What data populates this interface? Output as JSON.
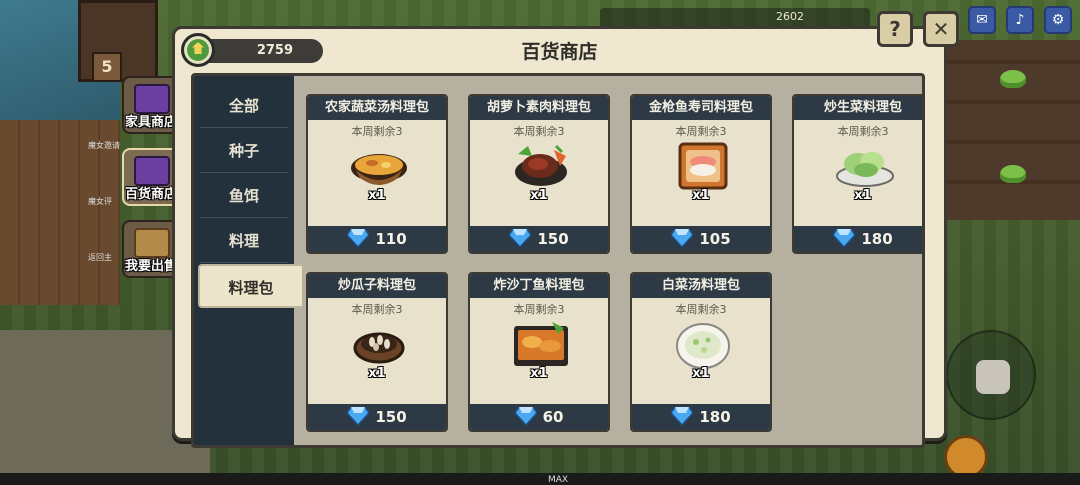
{
  "shop": {
    "title": "百货商店",
    "coins": "2759",
    "help_label": "?",
    "close_label": "✕"
  },
  "categories": [
    {
      "label": "全部",
      "active": false
    },
    {
      "label": "种子",
      "active": false
    },
    {
      "label": "鱼饵",
      "active": false
    },
    {
      "label": "料理",
      "active": false
    },
    {
      "label": "料理包",
      "active": true
    }
  ],
  "items": [
    {
      "name": "农家蔬菜汤料理包",
      "stock": "本周剩余3",
      "qty": "x1",
      "price": "110",
      "art": "soup-bowl-icon"
    },
    {
      "name": "胡萝卜素肉料理包",
      "stock": "本周剩余3",
      "qty": "x1",
      "price": "150",
      "art": "carrot-meat-icon"
    },
    {
      "name": "金枪鱼寿司料理包",
      "stock": "本周剩余3",
      "qty": "x1",
      "price": "105",
      "art": "tuna-sushi-icon"
    },
    {
      "name": "炒生菜料理包",
      "stock": "本周剩余3",
      "qty": "x1",
      "price": "180",
      "art": "stir-fried-lettuce-icon"
    },
    {
      "name": "炒瓜子料理包",
      "stock": "本周剩余3",
      "qty": "x1",
      "price": "150",
      "art": "sunflower-seeds-icon"
    },
    {
      "name": "炸沙丁鱼料理包",
      "stock": "本周剩余3",
      "qty": "x1",
      "price": "60",
      "art": "fried-sardine-icon"
    },
    {
      "name": "白菜汤料理包",
      "stock": "本周剩余3",
      "qty": "x1",
      "price": "180",
      "art": "cabbage-soup-icon"
    }
  ],
  "side_menu": [
    {
      "label": "家具商店",
      "active": false
    },
    {
      "label": "百货商店",
      "active": true
    },
    {
      "label": "我要出售",
      "active": false
    }
  ],
  "side_small_labels": [
    "魔女邀请",
    "魔女评",
    "返回主"
  ],
  "hud": {
    "counter": "2602",
    "house_number": "5",
    "max_label": "MAX"
  },
  "colors": {
    "panel": "#efe7cf",
    "tab_bar": "#22313b",
    "card_header": "#2d3a45",
    "gem": "#4aa8f0"
  }
}
